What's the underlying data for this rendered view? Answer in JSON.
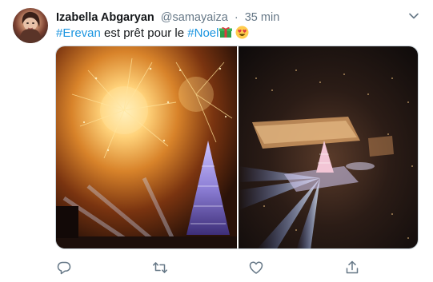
{
  "tweet": {
    "author_name": "Izabella Abgaryan",
    "author_handle": "@samayaiza",
    "separator": "·",
    "time": "35 min",
    "text_hashtag_1": "#Erevan",
    "text_middle": " est prêt pour le ",
    "text_hashtag_2": "#Noel",
    "emoji_1": "wrapped-gift-icon",
    "emoji_2": "heart-eyes-icon",
    "hashtag_color": "#1b95e0"
  },
  "media": {
    "images": [
      {
        "name": "fireworks-tree-photo"
      },
      {
        "name": "aerial-square-photo"
      }
    ]
  },
  "actions": [
    {
      "name": "reply-icon"
    },
    {
      "name": "retweet-icon"
    },
    {
      "name": "like-icon"
    },
    {
      "name": "share-icon"
    }
  ]
}
